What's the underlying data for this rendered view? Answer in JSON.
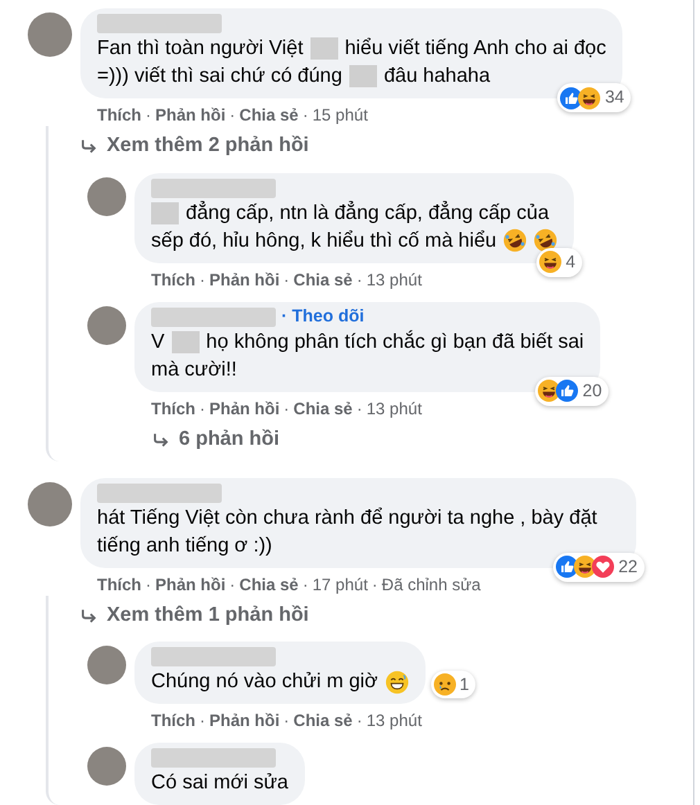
{
  "separator": "·",
  "comments": [
    {
      "lines": [
        [
          {
            "kind": "text",
            "text": "Fan thì toàn người Việt"
          },
          {
            "kind": "redacted"
          },
          {
            "kind": "text",
            "text": "hiểu viết tiếng Anh cho ai đọc"
          }
        ],
        [
          {
            "kind": "text",
            "text": "=))) viết thì sai chứ có đúng"
          },
          {
            "kind": "redacted"
          },
          {
            "kind": "text",
            "text": "đâu hahaha"
          }
        ]
      ],
      "reactions": {
        "icons": [
          {
            "kind": "like"
          },
          {
            "kind": "haha"
          }
        ],
        "count": "34"
      },
      "actions": [
        "Thích",
        "Phản hồi",
        "Chia sẻ"
      ],
      "time": "15 phút",
      "more_link": "Xem thêm 2 phản hồi",
      "children": [
        {
          "lines": [
            [
              {
                "kind": "redacted"
              },
              {
                "kind": "text",
                "text": "đẳng cấp, ntn là đẳng cấp, đẳng cấp của"
              }
            ],
            [
              {
                "kind": "text",
                "text": "sếp đó, hỉu hông, k hiểu thì cố mà hiểu"
              },
              {
                "kind": "rofl"
              },
              {
                "kind": "rofl"
              }
            ]
          ],
          "reactions": {
            "icons": [
              {
                "kind": "haha"
              }
            ],
            "count": "4"
          },
          "actions": [
            "Thích",
            "Phản hồi",
            "Chia sẻ"
          ],
          "time": "13 phút"
        },
        {
          "follow_link": "· Theo dõi",
          "lines": [
            [
              {
                "kind": "text",
                "text": "V"
              },
              {
                "kind": "redacted"
              },
              {
                "kind": "text",
                "text": "họ không phân tích chắc gì bạn đã biết sai"
              }
            ],
            [
              {
                "kind": "text",
                "text": "mà cười!!"
              }
            ]
          ],
          "reactions": {
            "icons": [
              {
                "kind": "haha"
              },
              {
                "kind": "like"
              }
            ],
            "count": "20"
          },
          "actions": [
            "Thích",
            "Phản hồi",
            "Chia sẻ"
          ],
          "time": "13 phút",
          "replies_link": "6 phản hồi"
        }
      ]
    },
    {
      "lines": [
        [
          {
            "kind": "text",
            "text": "hát Tiếng Việt còn chưa rành để người ta nghe , bày đặt tiếng anh tiếng ơ :))"
          }
        ]
      ],
      "reactions": {
        "icons": [
          {
            "kind": "like"
          },
          {
            "kind": "haha"
          },
          {
            "kind": "love"
          }
        ],
        "count": "22"
      },
      "actions": [
        "Thích",
        "Phản hồi",
        "Chia sẻ"
      ],
      "time": "17 phút",
      "edited": "Đã chỉnh sửa",
      "more_link": "Xem thêm 1 phản hồi",
      "children": [
        {
          "lines": [
            [
              {
                "kind": "text",
                "text": "Chúng nó vào chửi m giờ"
              },
              {
                "kind": "smile"
              }
            ]
          ],
          "reactions": {
            "icons": [
              {
                "kind": "sad"
              }
            ],
            "count": "1"
          },
          "actions": [
            "Thích",
            "Phản hồi",
            "Chia sẻ"
          ],
          "time": "13 phút"
        },
        {
          "lines": [
            [
              {
                "kind": "text",
                "text": "Có sai mới sửa"
              }
            ]
          ]
        }
      ]
    }
  ]
}
